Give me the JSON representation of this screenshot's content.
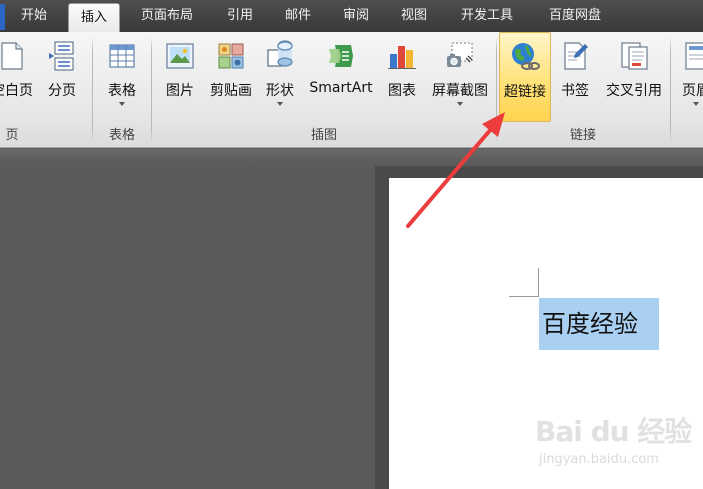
{
  "tabs": [
    {
      "label": "开始",
      "active": false
    },
    {
      "label": "插入",
      "active": true
    },
    {
      "label": "页面布局",
      "active": false
    },
    {
      "label": "引用",
      "active": false
    },
    {
      "label": "邮件",
      "active": false
    },
    {
      "label": "审阅",
      "active": false
    },
    {
      "label": "视图",
      "active": false
    },
    {
      "label": "开发工具",
      "active": false
    },
    {
      "label": "百度网盘",
      "active": false
    }
  ],
  "ribbon": {
    "pages_group": {
      "label": "页",
      "buttons": [
        {
          "label": "空白页",
          "icon": "blank-page-icon"
        },
        {
          "label": "分页",
          "icon": "page-break-icon"
        }
      ]
    },
    "tables_group": {
      "label": "表格",
      "buttons": [
        {
          "label": "表格",
          "icon": "table-icon",
          "dropdown": true
        }
      ]
    },
    "illustrations_group": {
      "label": "插图",
      "buttons": [
        {
          "label": "图片",
          "icon": "picture-icon"
        },
        {
          "label": "剪贴画",
          "icon": "clip-art-icon"
        },
        {
          "label": "形状",
          "icon": "shapes-icon",
          "dropdown": true
        },
        {
          "label": "SmartArt",
          "icon": "smartart-icon"
        },
        {
          "label": "图表",
          "icon": "chart-icon"
        },
        {
          "label": "屏幕截图",
          "icon": "screenshot-icon",
          "dropdown": true
        }
      ]
    },
    "links_group": {
      "label": "链接",
      "buttons": [
        {
          "label": "超链接",
          "icon": "hyperlink-icon",
          "highlighted": true
        },
        {
          "label": "书签",
          "icon": "bookmark-icon"
        },
        {
          "label": "交叉引用",
          "icon": "cross-reference-icon"
        }
      ]
    },
    "header_footer_group": {
      "buttons": [
        {
          "label": "页眉",
          "icon": "header-icon"
        }
      ]
    }
  },
  "document": {
    "selected_text": "百度经验"
  },
  "watermark": {
    "main": "Bai du 经验",
    "sub": "jingyan.baidu.com"
  },
  "colors": {
    "tab_bar": "#393939",
    "selection": "#a9cff2",
    "highlight_button": "#ffe27a",
    "arrow": "#ee3b3b",
    "workspace": "#5b5b5b"
  }
}
